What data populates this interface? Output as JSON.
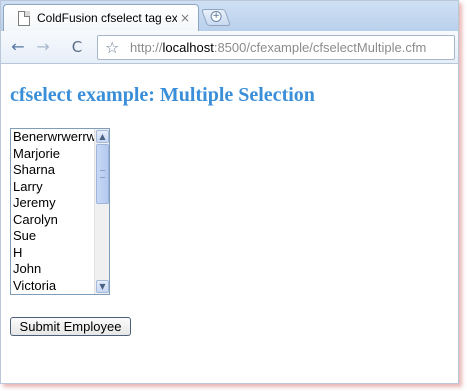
{
  "browser": {
    "tab_title": "ColdFusion cfselect tag ex…",
    "tab_close": "×",
    "new_tab": "+",
    "back": "←",
    "forward": "→",
    "reload": "C",
    "star": "☆",
    "url_prefix": "http://",
    "url_host": "localhost",
    "url_rest": ":8500/cfexample/cfselectMultiple.cfm"
  },
  "page": {
    "heading": "cfselect example: Multiple Selection",
    "employees": [
      "Benerwrwerrw",
      "Marjorie",
      "Sharna",
      "Larry",
      "Jeremy",
      "Carolyn",
      "Sue",
      "H",
      "John",
      "Victoria"
    ],
    "submit_label": "Submit Employee"
  },
  "colors": {
    "heading": "#3a8fd8",
    "tab_strip": "#cfe0f4"
  }
}
